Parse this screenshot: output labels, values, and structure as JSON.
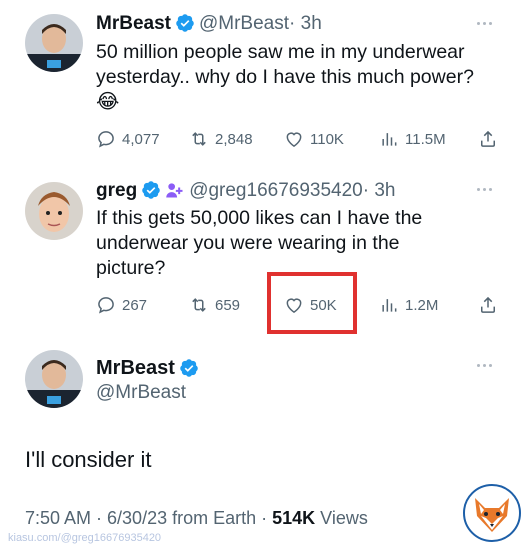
{
  "tweet1": {
    "name": "MrBeast",
    "handle": "@MrBeast",
    "time": "· 3h",
    "text": "50 million people saw me in my underwear yesterday.. why do I have this much power?",
    "emoji": "😂",
    "replies": "4,077",
    "retweets": "2,848",
    "likes": "110K",
    "views": "11.5M"
  },
  "tweet2": {
    "name": "greg",
    "handle": "@greg16676935420",
    "time": "· 3h",
    "text": "If this gets 50,000 likes can I have the underwear you were wearing in the picture?",
    "replies": "267",
    "retweets": "659",
    "likes": "50K",
    "views": "1.2M"
  },
  "main": {
    "name": "MrBeast",
    "handle": "@MrBeast",
    "text": "I'll consider it",
    "timestamp": "7:50 AM · 6/30/23 from Earth · ",
    "views_count": "514K",
    "views_label": " Views"
  },
  "watermark": "kiasu.com/@greg16676935420",
  "colors": {
    "verified": "#1d9bf0",
    "highlight": "#e0312f",
    "muted": "#536471"
  }
}
